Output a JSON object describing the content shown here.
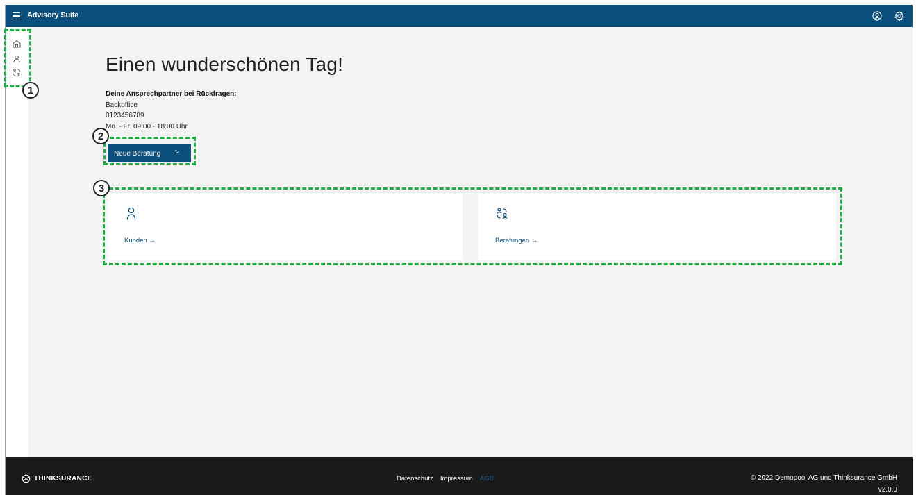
{
  "topbar": {
    "title": "Advisory Suite",
    "menu_icon": "hamburger-menu-icon",
    "right_icons": [
      "user-profile-icon",
      "settings-icon"
    ]
  },
  "sidebar": {
    "items": [
      {
        "icon": "home-icon"
      },
      {
        "icon": "person-icon"
      },
      {
        "icon": "consultation-icon"
      }
    ]
  },
  "main": {
    "greeting": "Einen wunderschönen Tag!",
    "contact": {
      "heading": "Deine Ansprechpartner bei Rückfragen:",
      "name": "Backoffice",
      "phone": "0123456789",
      "hours": "Mo. - Fr. 09:00 - 18:00 Uhr"
    },
    "new_button": {
      "label": "Neue Beratung",
      "chevron": ">"
    },
    "cards": [
      {
        "label": "Kunden →",
        "icon": "person-icon"
      },
      {
        "label": "Beratungen →",
        "icon": "consultation-icon"
      }
    ]
  },
  "annotations": [
    "1",
    "2",
    "3"
  ],
  "footer": {
    "brand": "THINKSURANCE",
    "links": [
      "Datenschutz",
      "Impressum",
      "AGB"
    ],
    "copyright": "© 2022 Demopool AG und Thinksurance GmbH",
    "version": "v2.0.0"
  },
  "colors": {
    "primary": "#0b4f7c",
    "background": "#f3f3f3",
    "annotation_green": "#22aa44",
    "footer_bg": "#1a1a1a",
    "agb_link": "#1a5f8f"
  }
}
